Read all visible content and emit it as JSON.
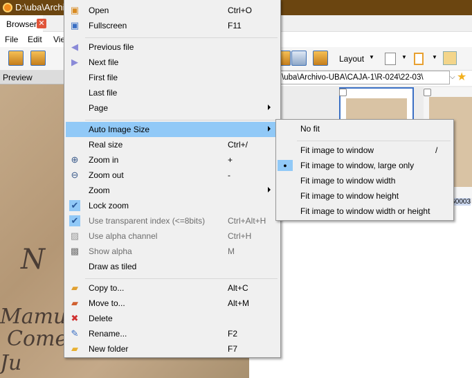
{
  "window": {
    "title": "D:\\uba\\Archivo-UBA"
  },
  "tabs": [
    {
      "label": "Browser",
      "close": "✕"
    }
  ],
  "menubar": [
    "File",
    "Edit",
    "View"
  ],
  "toolbar": {
    "layout_label": "Layout"
  },
  "preview": {
    "label": "Preview"
  },
  "address": {
    "value": "\\uba\\Archivo-UBA\\CAJA-1\\R-024\\22-03\\"
  },
  "thumbnail_caption": "G0003",
  "context_menu": [
    {
      "label": "Open",
      "shortcut": "Ctrl+O",
      "icon": "open-image-icon"
    },
    {
      "label": "Fullscreen",
      "shortcut": "F11",
      "icon": "fullscreen-icon"
    },
    {
      "sep": true
    },
    {
      "label": "Previous file",
      "icon": "arrow-left-icon"
    },
    {
      "label": "Next file",
      "icon": "arrow-right-icon"
    },
    {
      "label": "First file"
    },
    {
      "label": "Last file"
    },
    {
      "label": "Page",
      "submenu": true
    },
    {
      "sep": true
    },
    {
      "label": "Auto Image Size",
      "submenu": true,
      "highlighted": true
    },
    {
      "label": "Real size",
      "shortcut": "Ctrl+/"
    },
    {
      "label": "Zoom in",
      "shortcut": "+",
      "icon": "zoom-in-icon"
    },
    {
      "label": "Zoom out",
      "shortcut": "-",
      "icon": "zoom-out-icon"
    },
    {
      "label": "Zoom",
      "submenu": true
    },
    {
      "label": "Lock zoom",
      "checked": true,
      "icon": "checkmark-icon"
    },
    {
      "label": "Use transparent index (<=8bits)",
      "shortcut": "Ctrl+Alt+H",
      "disabled": true,
      "checked": true,
      "icon": "checkmark-icon"
    },
    {
      "label": "Use alpha channel",
      "shortcut": "Ctrl+H",
      "disabled": true,
      "icon": "alpha-channel-icon"
    },
    {
      "label": "Show alpha",
      "shortcut": "M",
      "disabled": true,
      "icon": "show-alpha-icon"
    },
    {
      "label": "Draw as tiled"
    },
    {
      "sep": true
    },
    {
      "label": "Copy to...",
      "shortcut": "Alt+C",
      "icon": "copy-to-folder-icon"
    },
    {
      "label": "Move to...",
      "shortcut": "Alt+M",
      "icon": "move-to-folder-icon"
    },
    {
      "label": "Delete",
      "icon": "delete-icon"
    },
    {
      "label": "Rename...",
      "shortcut": "F2",
      "icon": "rename-icon"
    },
    {
      "label": "New folder",
      "shortcut": "F7",
      "icon": "new-folder-icon"
    }
  ],
  "submenu": [
    {
      "label": "No fit"
    },
    {
      "sep": true
    },
    {
      "label": "Fit image to window",
      "shortcut": "/"
    },
    {
      "label": "Fit image to window, large only",
      "selected": true
    },
    {
      "label": "Fit image to window width"
    },
    {
      "label": "Fit image to window height"
    },
    {
      "label": "Fit image to window width or height"
    }
  ]
}
